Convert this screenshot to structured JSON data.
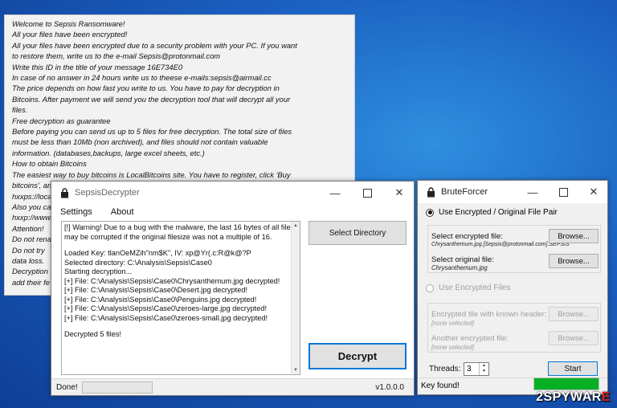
{
  "note": {
    "lines": [
      "Welcome to Sepsis Ransomware!",
      "All your files have been encrypted!",
      "All your files have been encrypted due to a security problem with your PC. If you want",
      "to restore them, write us to the e-mail Sepsis@protonmail.com",
      "Write this ID in the title of your message 16E734E0",
      "In case of no answer in 24 hours write us to theese e-mails:sepsis@airmail.cc",
      "The price depends on how fast you write to us. You have to pay for decryption in",
      "Bitcoins. After payment we will send you the decryption tool that will decrypt all your",
      "files.",
      "Free decryption as guarantee",
      "Before paying you can send us up to 5 files for free decryption. The total size of files",
      "must be less than 10Mb (non archived), and files should not contain valuable",
      "information. (databases,backups, large excel sheets, etc.)",
      "How to obtain Bitcoins",
      "The easiest way to buy bitcoins is LocalBitcoins site. You have to register, click 'Buy",
      "bitcoins', an",
      "hxxps://loca",
      "Also you ca",
      "hxxp://www.",
      "Attention!",
      "Do not rena",
      "Do not try",
      "data loss.",
      "Decryption",
      "add their fe"
    ]
  },
  "decrypter": {
    "title": "SepsisDecrypter",
    "menu": [
      "Settings",
      "About"
    ],
    "log": [
      "[!] Warning! Due to a bug with the malware, the last 16 bytes of all files",
      "may be corrupted if the original filesize was not a multiple of 16.",
      "",
      "Loaded Key: tlanOeMZih\"nm$K\", IV: xp@Yr(.c:R@k@?P",
      "Selected directory: C:\\Analysis\\Sepsis\\Case0",
      "Starting decryption...",
      "[+] File: C:\\Analysis\\Sepsis\\Case0\\Chrysanthemum.jpg decrypted!",
      "[+] File: C:\\Analysis\\Sepsis\\Case0\\Desert.jpg decrypted!",
      "[+] File: C:\\Analysis\\Sepsis\\Case0\\Penguins.jpg decrypted!",
      "[+] File: C:\\Analysis\\Sepsis\\Case0\\zeroes-large.jpg decrypted!",
      "[+] File: C:\\Analysis\\Sepsis\\Case0\\zeroes-small.jpg decrypted!",
      "",
      "Decrypted 5 files!"
    ],
    "select_directory_label": "Select Directory",
    "decrypt_label": "Decrypt",
    "status": "Done!",
    "version": "v1.0.0.0"
  },
  "bruteforcer": {
    "title": "BruteForcer",
    "mode1_label": "Use Encrypted / Original File Pair",
    "encrypted_label": "Select encrypted file:",
    "encrypted_value": "Chrysanthemum.jpg.[Sepsis@protonmail.com].SEPSIS",
    "original_label": "Select original file:",
    "original_value": "Chrysanthemum.jpg",
    "browse_label": "Browse...",
    "mode2_label": "Use Encrypted Files",
    "known_header_label": "Encrypted file with known header:",
    "another_label": "Another encrypted file:",
    "none_selected": "[none selected]",
    "threads_label": "Threads:",
    "threads_value": "3",
    "start_label": "Start",
    "status": "Key found!",
    "progress": 1.0
  },
  "watermark": {
    "part1": "2",
    "part2": "SPYWAR",
    "part3": "E"
  },
  "colors": {
    "progress": "#06b025",
    "desktop": "#1a5fc0"
  }
}
